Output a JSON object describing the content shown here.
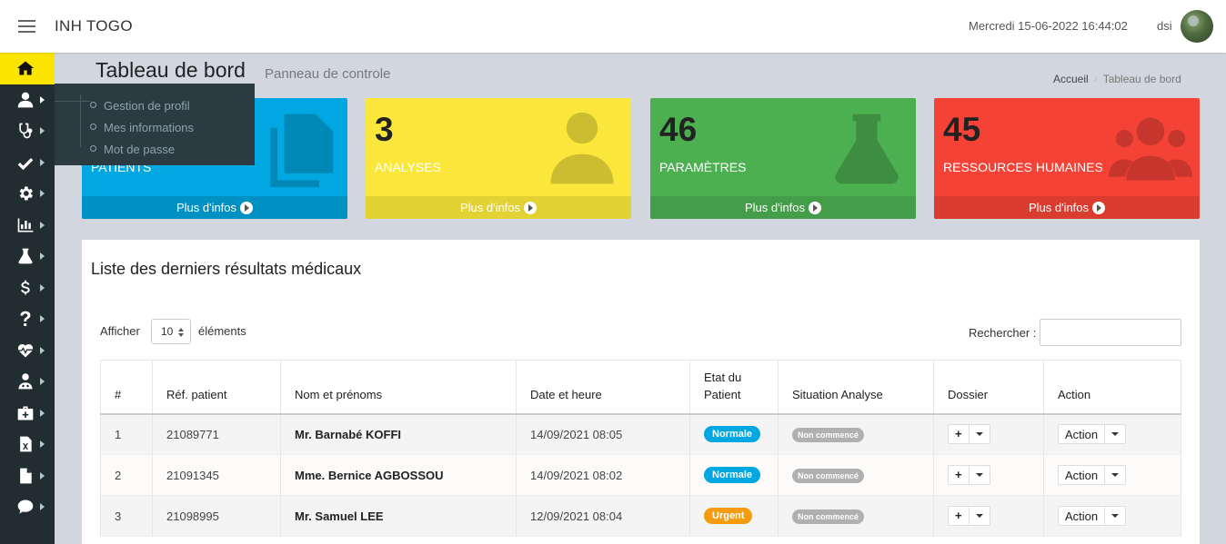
{
  "header": {
    "brand": "INH TOGO",
    "datetime": "Mercredi 15-06-2022 16:44:02",
    "username": "dsi"
  },
  "sidebar": {
    "items": [
      {
        "icon": "home-icon"
      },
      {
        "icon": "user-icon"
      },
      {
        "icon": "stethoscope-icon"
      },
      {
        "icon": "check-icon"
      },
      {
        "icon": "gear-icon"
      },
      {
        "icon": "bar-chart-icon"
      },
      {
        "icon": "flask-icon"
      },
      {
        "icon": "dollar-icon"
      },
      {
        "icon": "question-icon"
      },
      {
        "icon": "heartbeat-icon"
      },
      {
        "icon": "user-md-icon"
      },
      {
        "icon": "medkit-icon"
      },
      {
        "icon": "file-excel-icon"
      },
      {
        "icon": "file-icon"
      },
      {
        "icon": "comment-icon"
      }
    ],
    "flyout": [
      "Gestion de profil",
      "Mes informations",
      "Mot de passe"
    ]
  },
  "page": {
    "title": "Tableau de bord",
    "subtitle": "Panneau de controle",
    "breadcrumb": {
      "home": "Accueil",
      "current": "Tableau de bord"
    }
  },
  "stats": [
    {
      "value": "",
      "label": "PATIENTS",
      "more": "Plus d'infos",
      "color": "#00a7e1",
      "icon": "files-icon"
    },
    {
      "value": "3",
      "label": "ANALYSES",
      "more": "Plus d'infos",
      "color": "#fbe73c",
      "icon": "user-md-icon"
    },
    {
      "value": "46",
      "label": "PARAMÈTRES",
      "more": "Plus d'infos",
      "color": "#4caf50",
      "icon": "flask-icon"
    },
    {
      "value": "45",
      "label": "RESSOURCES HUMAINES",
      "more": "Plus d'infos",
      "color": "#f44336",
      "icon": "users-icon"
    }
  ],
  "panel": {
    "title": "Liste des derniers résultats médicaux",
    "show_label": "Afficher",
    "show_value": "10",
    "show_suffix": "éléments",
    "search_label": "Rechercher :",
    "columns": [
      "#",
      "Réf. patient",
      "Nom et prénoms",
      "Date et heure",
      "Etat du Patient",
      "Situation Analyse",
      "Dossier",
      "Action"
    ],
    "rows": [
      {
        "num": "1",
        "ref": "21089771",
        "name": "Mr. Barnabé KOFFI",
        "date": "14/09/2021 08:05",
        "etat": "Normale",
        "situation": "Non commencé",
        "action": "Action"
      },
      {
        "num": "2",
        "ref": "21091345",
        "name": "Mme. Bernice AGBOSSOU",
        "date": "14/09/2021 08:02",
        "etat": "Normale",
        "situation": "Non commencé",
        "action": "Action"
      },
      {
        "num": "3",
        "ref": "21098995",
        "name": "Mr. Samuel LEE",
        "date": "12/09/2021 08:04",
        "etat": "Urgent",
        "situation": "Non commencé",
        "action": "Action"
      }
    ]
  }
}
